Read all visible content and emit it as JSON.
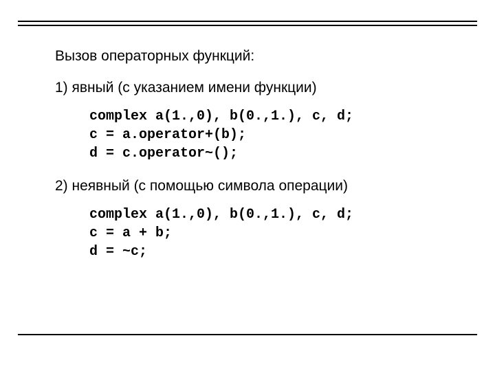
{
  "heading": "Вызов операторных функций:",
  "sections": [
    {
      "label": "1) явный (с указанием имени функции)",
      "code": "complex a(1.,0), b(0.,1.), c, d;\nc = a.operator+(b);\nd = c.operator~();"
    },
    {
      "label": "2) неявный (с помощью символа операции)",
      "code": "complex a(1.,0), b(0.,1.), c, d;\nc = a + b;\nd = ~c;"
    }
  ]
}
